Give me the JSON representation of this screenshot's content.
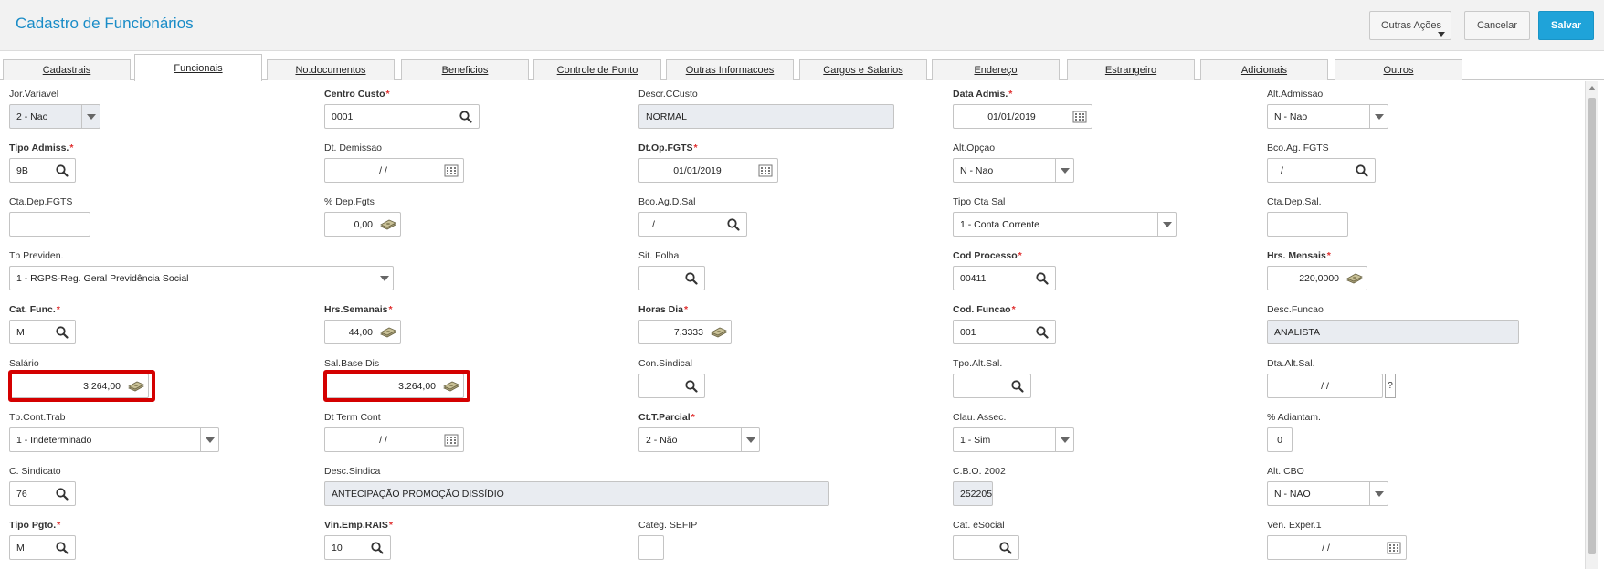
{
  "header": {
    "title": "Cadastro de Funcionários",
    "outras_label": "Outras Ações",
    "cancelar_label": "Cancelar",
    "salvar_label": "Salvar",
    "accent_color": "#1fa3d9"
  },
  "tabs": [
    "Cadastrais",
    "Funcionais",
    "No.documentos",
    "Beneficios",
    "Controle de Ponto",
    "Outras Informacoes",
    "Cargos e Salarios",
    "Endereço",
    "Estrangeiro",
    "Adicionais",
    "Outros"
  ],
  "active_tab": "Funcionais",
  "fields": {
    "jor_variavel": {
      "label": "Jor.Variavel",
      "value": "2 - Nao"
    },
    "centro_custo": {
      "label": "Centro Custo",
      "value": "0001"
    },
    "descr_ccusto": {
      "label": "Descr.CCusto",
      "value": "NORMAL"
    },
    "data_admis": {
      "label": "Data Admis.",
      "value": "01/01/2019"
    },
    "alt_admissao": {
      "label": "Alt.Admissao",
      "value": "N - Nao"
    },
    "tipo_admiss": {
      "label": "Tipo Admiss.",
      "value": "9B"
    },
    "dt_demissao": {
      "label": "Dt. Demissao",
      "value": "/ /"
    },
    "dt_op_fgts": {
      "label": "Dt.Op.FGTS",
      "value": "01/01/2019"
    },
    "alt_opcao": {
      "label": "Alt.Opçao",
      "value": "N - Nao"
    },
    "bco_ag_fgts": {
      "label": "Bco.Ag. FGTS",
      "value": "/"
    },
    "cta_dep_fgts": {
      "label": "Cta.Dep.FGTS",
      "value": ""
    },
    "dep_fgts": {
      "label": "% Dep.Fgts",
      "value": "0,00"
    },
    "bco_ag_d_sal": {
      "label": "Bco.Ag.D.Sal",
      "value": "/"
    },
    "tipo_cta_sal": {
      "label": "Tipo Cta Sal",
      "value": "1 - Conta Corrente"
    },
    "cta_dep_sal": {
      "label": "Cta.Dep.Sal.",
      "value": ""
    },
    "tp_previden": {
      "label": "Tp Previden.",
      "value": "1 - RGPS-Reg. Geral Previdência Social"
    },
    "sit_folha": {
      "label": "Sit. Folha",
      "value": ""
    },
    "cod_processo": {
      "label": "Cod Processo",
      "value": "00411"
    },
    "hrs_mensais": {
      "label": "Hrs. Mensais",
      "value": "220,0000"
    },
    "cat_func": {
      "label": "Cat. Func.",
      "value": "M"
    },
    "hrs_semanais": {
      "label": "Hrs.Semanais",
      "value": "44,00"
    },
    "horas_dia": {
      "label": "Horas Dia",
      "value": "7,3333"
    },
    "cod_funcao": {
      "label": "Cod. Funcao",
      "value": "001"
    },
    "desc_funcao": {
      "label": "Desc.Funcao",
      "value": "ANALISTA"
    },
    "salario": {
      "label": "Salário",
      "value": "3.264,00"
    },
    "sal_base_dis": {
      "label": "Sal.Base.Dis",
      "value": "3.264,00"
    },
    "con_sindical": {
      "label": "Con.Sindical",
      "value": ""
    },
    "tpo_alt_sal": {
      "label": "Tpo.Alt.Sal.",
      "value": ""
    },
    "dta_alt_sal": {
      "label": "Dta.Alt.Sal.",
      "value": "/ /"
    },
    "tp_cont_trab": {
      "label": "Tp.Cont.Trab",
      "value": "1 - Indeterminado"
    },
    "dt_term_cont": {
      "label": "Dt Term Cont",
      "value": "/ /"
    },
    "ct_t_parcial": {
      "label": "Ct.T.Parcial",
      "value": "2 - Não"
    },
    "clau_assec": {
      "label": "Clau. Assec.",
      "value": "1 - Sim"
    },
    "adiantam": {
      "label": "% Adiantam.",
      "value": "0"
    },
    "c_sindicato": {
      "label": "C. Sindicato",
      "value": "76"
    },
    "desc_sindica": {
      "label": "Desc.Sindica",
      "value": "ANTECIPAÇÃO PROMOÇÃO DISSÍDIO"
    },
    "cbo_2002": {
      "label": "C.B.O. 2002",
      "value": "252205"
    },
    "alt_cbo": {
      "label": "Alt. CBO",
      "value": "N - NAO"
    },
    "tipo_pgto": {
      "label": "Tipo Pgto.",
      "value": "M"
    },
    "vin_emp_rais": {
      "label": "Vin.Emp.RAIS",
      "value": "10"
    },
    "categ_sefip": {
      "label": "Categ. SEFIP",
      "value": ""
    },
    "cat_esocial": {
      "label": "Cat. eSocial",
      "value": ""
    },
    "ven_exper_1": {
      "label": "Ven. Exper.1",
      "value": "/ /"
    }
  },
  "required_marker": "*",
  "help_marker": "?"
}
